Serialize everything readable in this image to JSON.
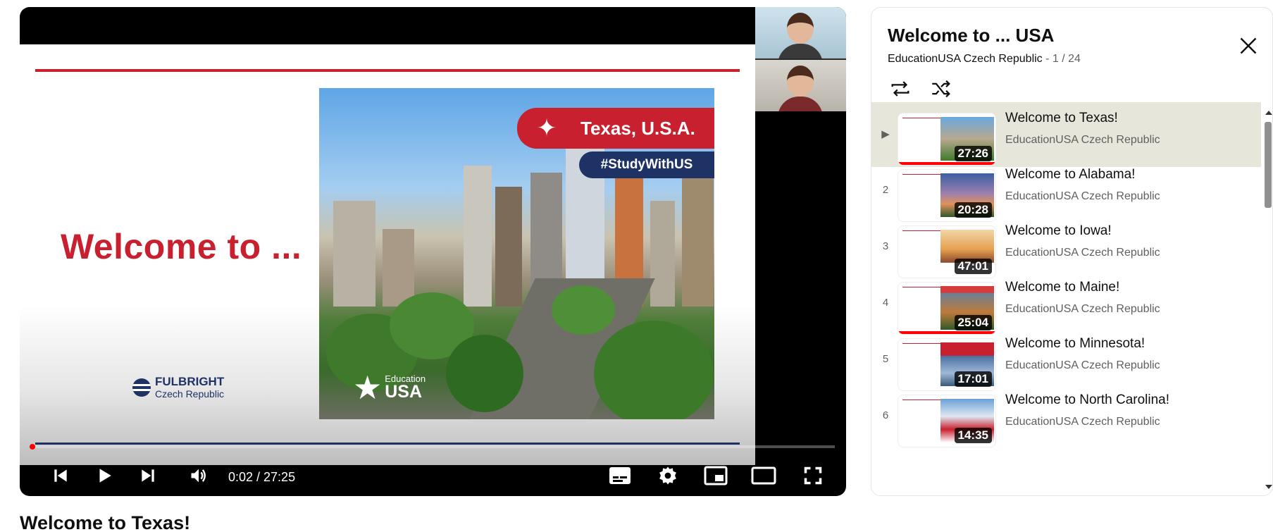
{
  "player": {
    "slide": {
      "welcome_text": "Welcome to ...",
      "fulbright_name": "FULBRIGHT",
      "fulbright_country": "Czech Republic",
      "photo_banner": "Texas, U.S.A.",
      "photo_hashtag": "#StudyWithUS",
      "edu_small": "Education",
      "edu_big": "USA"
    },
    "time": "0:02 / 27:25",
    "progress_fraction": 0.0012,
    "icons": [
      "previous-icon",
      "play-icon",
      "next-icon",
      "volume-icon",
      "subtitles-icon",
      "settings-icon",
      "miniplayer-icon",
      "theater-icon",
      "fullscreen-icon"
    ]
  },
  "video_title": "Welcome to Texas!",
  "playlist": {
    "title": "Welcome to ... USA",
    "channel": "EducationUSA Czech Republic",
    "position": " - 1 / 24",
    "items": [
      {
        "index": "▶",
        "title": "Welcome to Texas!",
        "channel": "EducationUSA Czech Republic",
        "duration": "27:26",
        "active": true,
        "watched_fraction": 1.0
      },
      {
        "index": "2",
        "title": "Welcome to Alabama!",
        "channel": "EducationUSA Czech Republic",
        "duration": "20:28",
        "active": false,
        "watched_fraction": 0
      },
      {
        "index": "3",
        "title": "Welcome to Iowa!",
        "channel": "EducationUSA Czech Republic",
        "duration": "47:01",
        "active": false,
        "watched_fraction": 0
      },
      {
        "index": "4",
        "title": "Welcome to Maine!",
        "channel": "EducationUSA Czech Republic",
        "duration": "25:04",
        "active": false,
        "watched_fraction": 1.0
      },
      {
        "index": "5",
        "title": "Welcome to Minnesota!",
        "channel": "EducationUSA Czech Republic",
        "duration": "17:01",
        "active": false,
        "watched_fraction": 0
      },
      {
        "index": "6",
        "title": "Welcome to North Carolina!",
        "channel": "EducationUSA Czech Republic",
        "duration": "14:35",
        "active": false,
        "watched_fraction": 0
      }
    ]
  },
  "colors": {
    "brand_red": "#c8202f",
    "brand_navy": "#1e3266",
    "progress_red": "#ff0000",
    "active_row": "#e7e6da"
  }
}
